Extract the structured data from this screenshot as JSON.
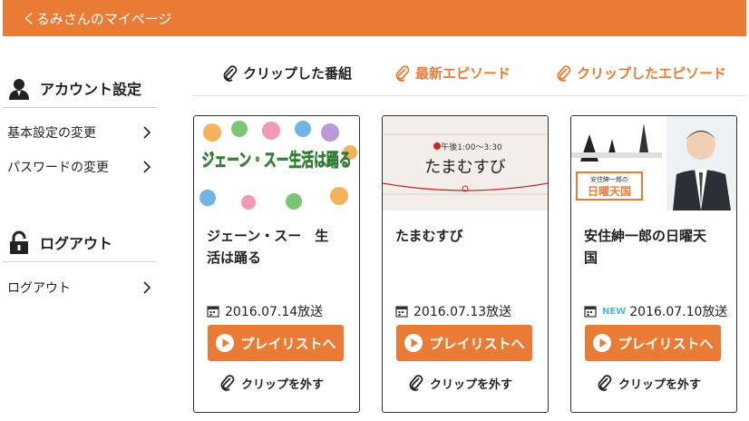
{
  "header": {
    "title": "くるみさんのマイページ"
  },
  "sidebar": {
    "account": {
      "title": "アカウント設定",
      "items": [
        {
          "label": "基本設定の変更"
        },
        {
          "label": "パスワードの変更"
        }
      ]
    },
    "logout": {
      "title": "ログアウト",
      "items": [
        {
          "label": "ログアウト"
        }
      ]
    }
  },
  "tabs": [
    {
      "label": "クリップした番組",
      "active": true
    },
    {
      "label": "最新エピソード",
      "active": false
    },
    {
      "label": "クリップしたエピソード",
      "active": false
    }
  ],
  "cards": [
    {
      "title_line1": "ジェーン・スー　生",
      "title_line2": "活は踊る",
      "date": "2016.07.14放送",
      "new": "",
      "play_label": "プレイリストへ",
      "unclip_label": "クリップを外す",
      "thumb_text": "ジェーン・スー生活は踊る"
    },
    {
      "title_line1": "たまむすび",
      "title_line2": "",
      "date": "2016.07.13放送",
      "new": "",
      "play_label": "プレイリストへ",
      "unclip_label": "クリップを外す",
      "thumb_text": "たまむすび",
      "thumb_subtext": "午後1:00～3:30"
    },
    {
      "title_line1": "安住紳一郎の日曜天",
      "title_line2": "国",
      "date": "2016.07.10放送",
      "new": "NEW",
      "play_label": "プレイリストへ",
      "unclip_label": "クリップを外す",
      "thumb_text": "日曜天国",
      "thumb_subtext": "安住紳一郎の"
    }
  ],
  "colors": {
    "accent": "#ea7b34",
    "new_badge": "#4fb6e6"
  },
  "icons": {
    "account": "person-icon",
    "logout": "padlock-icon",
    "clip": "paperclip-icon",
    "calendar": "calendar-icon",
    "play": "play-icon",
    "chevron": "chevron-right-icon"
  }
}
